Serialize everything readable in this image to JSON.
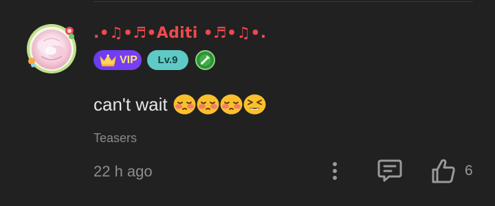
{
  "comment": {
    "username": ".•♫•♬•Aditi •♬•♫•.",
    "vip_label": "VIP",
    "level_label": "Lv.9",
    "text": "can't wait",
    "emojis": [
      "flushed-face-emoji",
      "flushed-face-emoji",
      "flushed-face-emoji",
      "squinting-face-emoji"
    ],
    "tag": "Teasers",
    "timestamp": "22 h ago",
    "like_count": "6"
  },
  "icons": {
    "avatar": "flower-avatar",
    "vip": "crown-icon",
    "medal": "medal-icon",
    "more": "more-vertical-icon",
    "reply": "comment-reply-icon",
    "like": "thumbs-up-icon"
  },
  "colors": {
    "background": "#212121",
    "username": "#f0494b",
    "vip_badge": "#7b3ff2",
    "vip_text": "#ffe27a",
    "level_badge": "#5fc9c6",
    "level_text": "#12413f",
    "body_text": "#e6e6e6",
    "muted_text": "#8d8d8d",
    "icon": "#9a9a9a"
  }
}
